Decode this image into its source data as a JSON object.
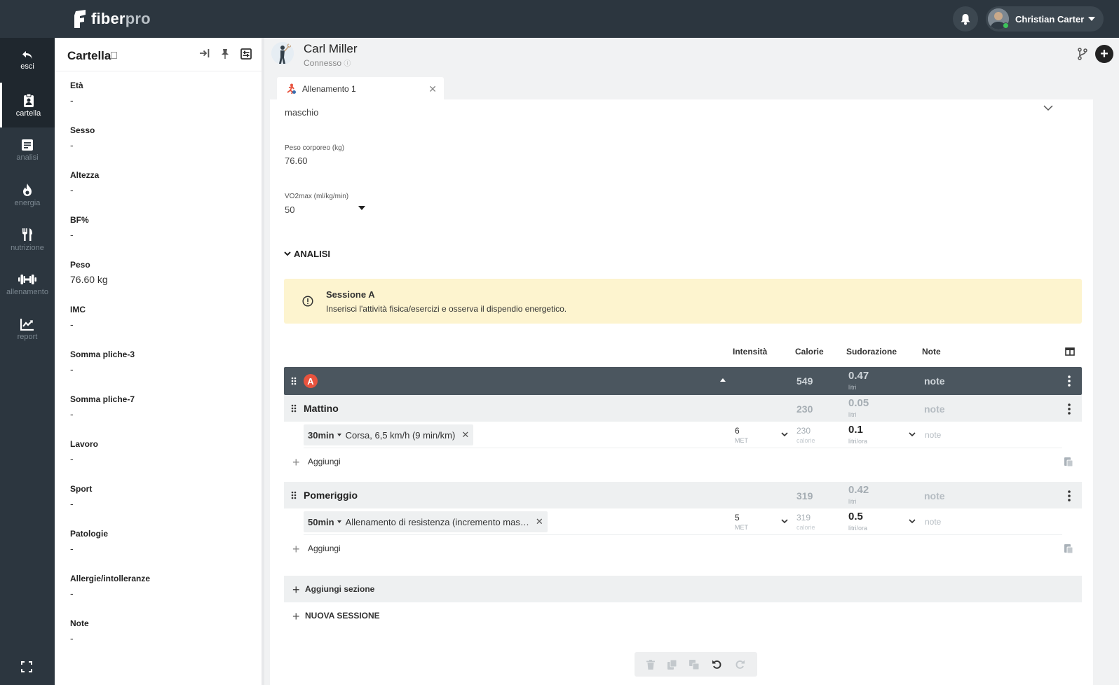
{
  "app": {
    "brand_part1": "fiber",
    "brand_part2": "pro",
    "user_name": "Christian Carter"
  },
  "nav": {
    "exit_label": "esci",
    "items": [
      {
        "label": "cartella",
        "icon": "clipboard-user-icon"
      },
      {
        "label": "analisi",
        "icon": "document-lines-icon"
      },
      {
        "label": "energia",
        "icon": "flame-icon"
      },
      {
        "label": "nutrizione",
        "icon": "utensils-icon"
      },
      {
        "label": "allenamento",
        "icon": "dumbbell-icon"
      },
      {
        "label": "report",
        "icon": "chart-line-icon"
      }
    ]
  },
  "panel": {
    "title": "Cartella",
    "fields": [
      {
        "label": "Età",
        "value": "-"
      },
      {
        "label": "Sesso",
        "value": "-"
      },
      {
        "label": "Altezza",
        "value": "-"
      },
      {
        "label": "BF%",
        "value": "-"
      },
      {
        "label": "Peso",
        "value": "76.60 kg"
      },
      {
        "label": "IMC",
        "value": "-"
      },
      {
        "label": "Somma pliche-3",
        "value": "-"
      },
      {
        "label": "Somma pliche-7",
        "value": "-"
      },
      {
        "label": "Lavoro",
        "value": "-"
      },
      {
        "label": "Sport",
        "value": "-"
      },
      {
        "label": "Patologie",
        "value": "-"
      },
      {
        "label": "Allergie/intolleranze",
        "value": "-"
      },
      {
        "label": "Note",
        "value": "-"
      }
    ]
  },
  "client": {
    "name": "Carl Miller",
    "status": "Connesso"
  },
  "tab": {
    "label": "Allenamento 1"
  },
  "form": {
    "sex_value": "maschio",
    "weight_label": "Peso corporeo (kg)",
    "weight_value": "76.60",
    "vo2_label": "VO2max (ml/kg/min)",
    "vo2_value": "50"
  },
  "analysis": {
    "section_label": "ANALISI",
    "alert_title": "Sessione A",
    "alert_text": "Inserisci l'attività fisica/esercizi e osserva il dispendio energetico.",
    "columns": {
      "intensity": "Intensità",
      "calories": "Calorie",
      "sweat": "Sudorazione",
      "notes": "Note"
    },
    "session": {
      "badge": "A",
      "calories": "549",
      "sweat": "0.47",
      "sweat_unit": "litri",
      "note_placeholder": "note"
    },
    "groups": [
      {
        "title": "Mattino",
        "calories": "230",
        "sweat": "0.05",
        "sweat_unit": "litri",
        "note_placeholder": "note",
        "item": {
          "duration": "30min",
          "activity": "Corsa, 6,5 km/h (9 min/km)",
          "intensity": "6",
          "intensity_unit": "MET",
          "calories": "230",
          "calories_unit": "calorie",
          "sweat_rate": "0.1",
          "sweat_rate_unit": "litri/ora",
          "note_placeholder": "note"
        }
      },
      {
        "title": "Pomeriggio",
        "calories": "319",
        "sweat": "0.42",
        "sweat_unit": "litri",
        "note_placeholder": "note",
        "item": {
          "duration": "50min",
          "activity": "Allenamento di resistenza (incremento mas…",
          "intensity": "5",
          "intensity_unit": "MET",
          "calories": "319",
          "calories_unit": "calorie",
          "sweat_rate": "0.5",
          "sweat_rate_unit": "litri/ora",
          "note_placeholder": "note"
        }
      }
    ],
    "add_label": "Aggiungi",
    "add_section_label": "Aggiungi sezione",
    "new_session_label": "NUOVA SESSIONE"
  },
  "colors": {
    "topbar": "#2c363f",
    "session_row": "#4b565f",
    "badge": "#e8533e",
    "alert": "#fdf4cf",
    "online": "#3cc35a"
  }
}
